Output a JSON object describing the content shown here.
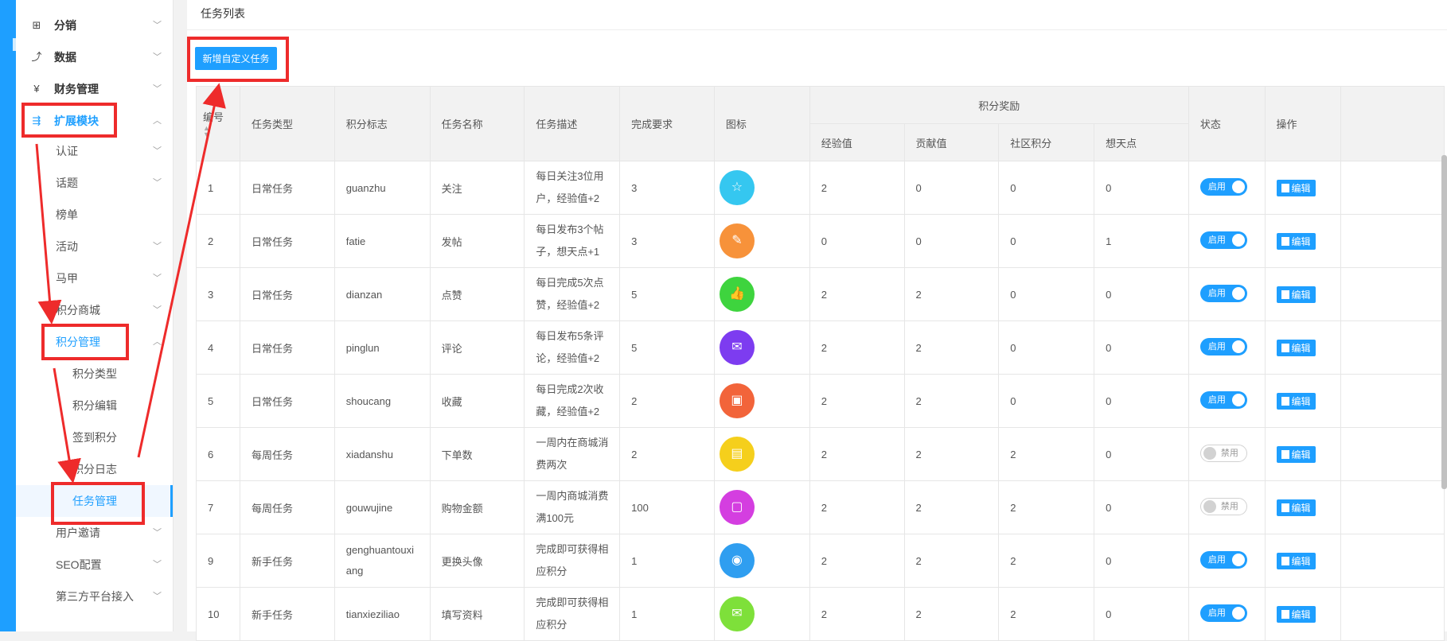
{
  "sidebar": {
    "items": [
      {
        "label": "分销",
        "icon": "sitemap-icon",
        "glyph": "⊞"
      },
      {
        "label": "数据",
        "icon": "line-chart-icon",
        "glyph": "⤴"
      },
      {
        "label": "财务管理",
        "icon": "finance-icon",
        "glyph": "¥"
      },
      {
        "label": "扩展模块",
        "icon": "extension-icon",
        "glyph": "⇶"
      },
      {
        "label": "认证"
      },
      {
        "label": "话题"
      },
      {
        "label": "榜单"
      },
      {
        "label": "活动"
      },
      {
        "label": "马甲"
      },
      {
        "label": "积分商城"
      },
      {
        "label": "积分管理"
      },
      {
        "label": "积分类型"
      },
      {
        "label": "积分编辑"
      },
      {
        "label": "签到积分"
      },
      {
        "label": "积分日志"
      },
      {
        "label": "任务管理"
      },
      {
        "label": "用户邀请"
      },
      {
        "label": "SEO配置"
      },
      {
        "label": "第三方平台接入"
      }
    ]
  },
  "breadcrumb": "任务列表",
  "add_button": "新增自定义任务",
  "table": {
    "headers": {
      "id": "编号",
      "type": "任务类型",
      "flag": "积分标志",
      "name": "任务名称",
      "desc": "任务描述",
      "req": "完成要求",
      "icon": "图标",
      "reward": "积分奖励",
      "exp": "经验值",
      "contrib": "贡献值",
      "community": "社区积分",
      "idea": "想天点",
      "status": "状态",
      "ops": "操作"
    },
    "rows": [
      {
        "id": "1",
        "type": "日常任务",
        "flag": "guanzhu",
        "name": "关注",
        "desc": [
          "每日关注3位用",
          "户，经验值+2"
        ],
        "req": "3",
        "icon": "star-icon",
        "color": "#35c7f0",
        "glyph": "☆",
        "exp": "2",
        "contrib": "0",
        "community": "0",
        "idea": "0",
        "status": "启用",
        "on": true
      },
      {
        "id": "2",
        "type": "日常任务",
        "flag": "fatie",
        "name": "发帖",
        "desc": [
          "每日发布3个帖",
          "子，想天点+1"
        ],
        "req": "3",
        "icon": "pencil-icon",
        "color": "#f7923a",
        "glyph": "✎",
        "exp": "0",
        "contrib": "0",
        "community": "0",
        "idea": "1",
        "status": "启用",
        "on": true
      },
      {
        "id": "3",
        "type": "日常任务",
        "flag": "dianzan",
        "name": "点赞",
        "desc": [
          "每日完成5次点",
          "赞，经验值+2"
        ],
        "req": "5",
        "icon": "thumbs-up-icon",
        "color": "#3ed43e",
        "glyph": "👍",
        "exp": "2",
        "contrib": "2",
        "community": "0",
        "idea": "0",
        "status": "启用",
        "on": true
      },
      {
        "id": "4",
        "type": "日常任务",
        "flag": "pinglun",
        "name": "评论",
        "desc": [
          "每日发布5条评",
          "论，经验值+2"
        ],
        "req": "5",
        "icon": "comment-icon",
        "color": "#7d3cf0",
        "glyph": "✉",
        "exp": "2",
        "contrib": "2",
        "community": "0",
        "idea": "0",
        "status": "启用",
        "on": true
      },
      {
        "id": "5",
        "type": "日常任务",
        "flag": "shoucang",
        "name": "收藏",
        "desc": [
          "每日完成2次收",
          "藏，经验值+2"
        ],
        "req": "2",
        "icon": "bookmark-icon",
        "color": "#f2643a",
        "glyph": "▣",
        "exp": "2",
        "contrib": "2",
        "community": "0",
        "idea": "0",
        "status": "启用",
        "on": true
      },
      {
        "id": "6",
        "type": "每周任务",
        "flag": "xiadanshu",
        "name": "下单数",
        "desc": [
          "一周内在商城消",
          "费两次"
        ],
        "req": "2",
        "icon": "document-icon",
        "color": "#f5cf1c",
        "glyph": "▤",
        "exp": "2",
        "contrib": "2",
        "community": "2",
        "idea": "0",
        "status": "禁用",
        "on": false
      },
      {
        "id": "7",
        "type": "每周任务",
        "flag": "gouwujine",
        "name": "购物金额",
        "desc": [
          "一周内商城消费",
          "满100元"
        ],
        "req": "100",
        "icon": "shopping-icon",
        "color": "#d43ee0",
        "glyph": "▢",
        "exp": "2",
        "contrib": "2",
        "community": "2",
        "idea": "0",
        "status": "禁用",
        "on": false
      },
      {
        "id": "9",
        "type": "新手任务",
        "flag": [
          "genghuantouxi",
          "ang"
        ],
        "name": "更换头像",
        "desc": [
          "完成即可获得相",
          "应积分"
        ],
        "req": "1",
        "icon": "avatar-icon",
        "color": "#2f9ef0",
        "glyph": "◉",
        "exp": "2",
        "contrib": "2",
        "community": "2",
        "idea": "0",
        "status": "启用",
        "on": true
      },
      {
        "id": "10",
        "type": "新手任务",
        "flag": "tianxieziliao",
        "name": "填写资料",
        "desc": [
          "完成即可获得相",
          "应积分"
        ],
        "req": "1",
        "icon": "profile-icon",
        "color": "#7ee03a",
        "glyph": "✉",
        "exp": "2",
        "contrib": "2",
        "community": "2",
        "idea": "0",
        "status": "启用",
        "on": true
      }
    ],
    "edit_label": "编辑"
  }
}
